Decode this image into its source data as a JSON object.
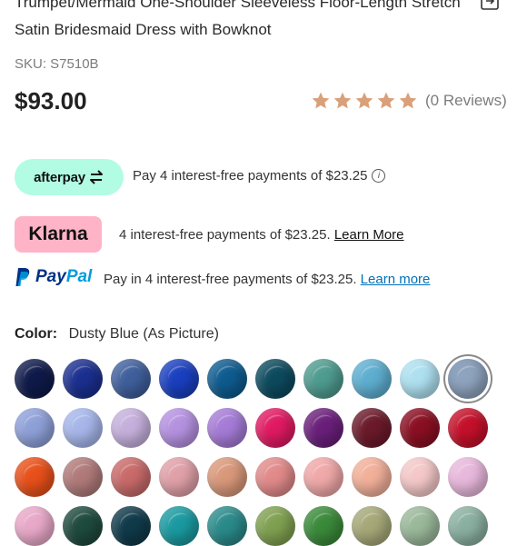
{
  "product": {
    "title": "Trumpet/Mermaid One-Shoulder Sleeveless Floor-Length Stretch Satin Bridesmaid Dress with Bowknot",
    "sku": "SKU: S7510B",
    "price": "$93.00",
    "rating_stars": 5,
    "reviews_label": "(0 Reviews)"
  },
  "payments": {
    "afterpay": {
      "logo_text": "afterpay",
      "text": "Pay 4 interest-free payments of $23.25"
    },
    "klarna": {
      "logo_text": "Klarna",
      "text": "4 interest-free payments of $23.25.",
      "link": "Learn More"
    },
    "paypal": {
      "logo_part1": "Pay",
      "logo_part2": "Pal",
      "text": "Pay in 4 interest-free payments of $23.25.",
      "link": "Learn more"
    }
  },
  "color": {
    "label": "Color:",
    "value": "Dusty Blue (As Picture)",
    "selected_index": 9,
    "swatches": [
      "#0f1a4a",
      "#1b2f8f",
      "#3f5f9c",
      "#1a3fbf",
      "#0e5b8f",
      "#0d4a5e",
      "#4e9b8f",
      "#5eaed0",
      "#aee0f0",
      "#8ea3bd",
      "#8ea0d8",
      "#a6b6ea",
      "#c5b0dc",
      "#b591e0",
      "#a57bd6",
      "#e01a62",
      "#6a1f7a",
      "#6b1a2a",
      "#8a0f22",
      "#c4102a",
      "#e8501a",
      "#b07a7a",
      "#c96a6a",
      "#e0a0a8",
      "#d9987a",
      "#e28a8a",
      "#f0a8a8",
      "#f2b09a",
      "#f4c8c8",
      "#e8b8dc",
      "#e8a8c8",
      "#1f4a3e",
      "#103a4a",
      "#1a9aa0",
      "#2a8a8a",
      "#7fa050",
      "#3a8a3a",
      "#a6a878",
      "#9ab89a",
      "#8ab0a0"
    ]
  }
}
